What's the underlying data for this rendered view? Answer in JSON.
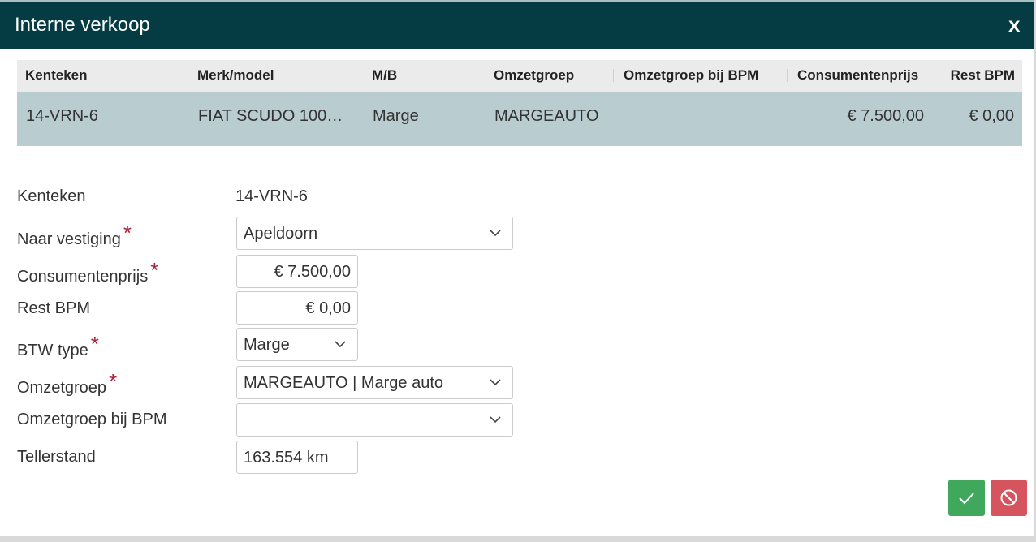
{
  "dialog": {
    "title": "Interne verkoop",
    "close_label": "x"
  },
  "grid": {
    "columns": [
      "Kenteken",
      "Merk/model",
      "M/B",
      "Omzetgroep",
      "Omzetgroep bij BPM",
      "Consumentenprijs",
      "Rest BPM"
    ],
    "row": {
      "kenteken": "14-VRN-6",
      "merk_model": "FIAT SCUDO 100…",
      "mb": "Marge",
      "omzetgroep": "MARGEAUTO",
      "omzetgroep_bpm": "",
      "consumentenprijs": "€ 7.500,00",
      "rest_bpm": "€ 0,00"
    }
  },
  "form": {
    "kenteken": {
      "label": "Kenteken",
      "value": "14-VRN-6"
    },
    "vestiging": {
      "label": "Naar vestiging",
      "value": "Apeldoorn"
    },
    "consumentenprijs": {
      "label": "Consumentenprijs",
      "value": "€ 7.500,00"
    },
    "rest_bpm": {
      "label": "Rest BPM",
      "value": "€ 0,00"
    },
    "btw_type": {
      "label": "BTW type",
      "value": "Marge"
    },
    "omzetgroep": {
      "label": "Omzetgroep",
      "value": "MARGEAUTO | Marge auto"
    },
    "omzetgroep_bpm": {
      "label": "Omzetgroep bij BPM",
      "value": ""
    },
    "tellerstand": {
      "label": "Tellerstand",
      "value": "163.554 km"
    },
    "required_marker": "*"
  },
  "actions": {
    "confirm_icon": "check-icon",
    "cancel_icon": "ban-icon"
  },
  "colors": {
    "titlebar": "#053c43",
    "selected_row": "#b9cccf",
    "confirm": "#3fa85c",
    "cancel": "#d5545e",
    "required": "#b0203a"
  }
}
